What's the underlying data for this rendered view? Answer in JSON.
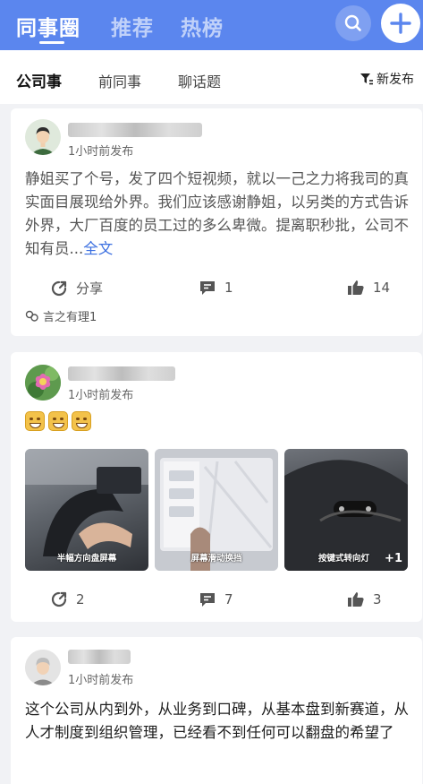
{
  "header": {
    "tabs": [
      {
        "label": "同事圈",
        "active": true
      },
      {
        "label": "推荐",
        "active": false
      },
      {
        "label": "热榜",
        "active": false
      }
    ],
    "search_icon": "search-icon",
    "add_icon": "plus-icon"
  },
  "subtabs": {
    "items": [
      {
        "label": "公司事",
        "active": true
      },
      {
        "label": "前同事",
        "active": false
      },
      {
        "label": "聊话题",
        "active": false
      }
    ],
    "new_post_label": "新发布",
    "sort_icon": "filter-sort-icon"
  },
  "posts": [
    {
      "time": "1小时前发布",
      "text": "静姐买了个号，发了四个短视频，就以一己之力将我司的真实面目展现给外界。我们应该感谢静姐，以另类的方式告诉外界，大厂百度的员工过的多么卑微。提离职秒批，公司不知有员...",
      "full_link": "全文",
      "share_label": "分享",
      "comments": "1",
      "likes": "14",
      "top_comment": "言之有理1"
    },
    {
      "time": "1小时前发布",
      "emoji_count": 3,
      "images": [
        {
          "caption": "半幅方向盘屏幕"
        },
        {
          "caption": "屏幕滑动换挡"
        },
        {
          "caption": "按键式转向灯",
          "more": "+1"
        }
      ],
      "shares": "2",
      "comments": "7",
      "likes": "3"
    },
    {
      "time": "1小时前发布",
      "text": "这个公司从内到外，从业务到口碑，从基本盘到新赛道，从人才制度到组织管理，已经看不到任何可以翻盘的希望了"
    }
  ],
  "colors": {
    "header_bg": "#5b86ee",
    "page_bg": "#f1f2f5",
    "link": "#3b6fe0"
  }
}
